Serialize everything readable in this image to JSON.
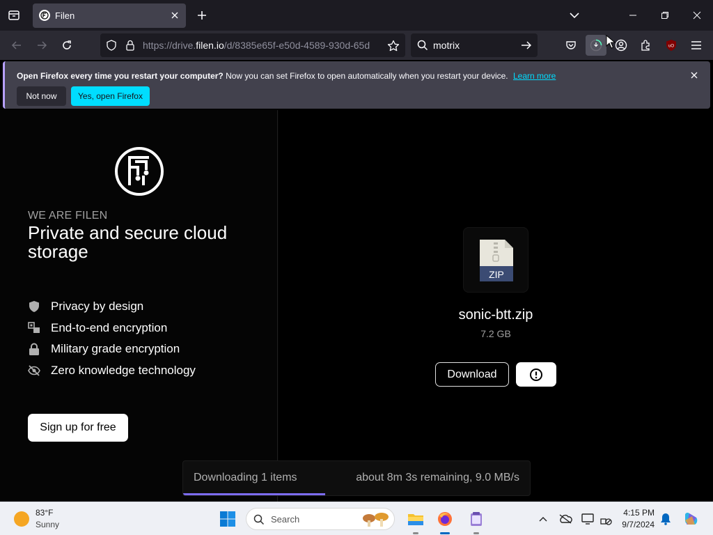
{
  "browser": {
    "tab": {
      "title": "Filen"
    },
    "url": {
      "prefix": "https://drive.",
      "host": "filen.io",
      "path": "/d/8385e65f-e50d-4589-930d-65d"
    },
    "search": {
      "value": "motrix"
    },
    "colors": {
      "accent": "#00ddff",
      "toolbar": "#2b2a33",
      "tabstrip": "#1c1b22"
    }
  },
  "notification": {
    "bold": "Open Firefox every time you restart your computer?",
    "text": " Now you can set Firefox to open automatically when you restart your device.",
    "link": "Learn more",
    "not_now": "Not now",
    "yes": "Yes, open Firefox"
  },
  "sidebar": {
    "tagline_small": "WE ARE FILEN",
    "tagline_big": "Private and secure cloud storage",
    "features": [
      {
        "icon": "shield-icon",
        "label": "Privacy by design"
      },
      {
        "icon": "encryption-icon",
        "label": "End-to-end encryption"
      },
      {
        "icon": "lock-icon",
        "label": "Military grade encryption"
      },
      {
        "icon": "eye-off-icon",
        "label": "Zero knowledge technology"
      }
    ],
    "signup": "Sign up for free"
  },
  "file": {
    "type_label": "ZIP",
    "name": "sonic-btt.zip",
    "size": "7.2 GB",
    "download": "Download"
  },
  "download_status": {
    "label": "Downloading 1 items",
    "eta": "about 8m 3s remaining, 9.0 MB/s",
    "progress": 0.41,
    "color": "#7c6cf0"
  },
  "taskbar": {
    "weather_temp": "83°F",
    "weather_desc": "Sunny",
    "search_placeholder": "Search",
    "time": "4:15 PM",
    "date": "9/7/2024"
  }
}
